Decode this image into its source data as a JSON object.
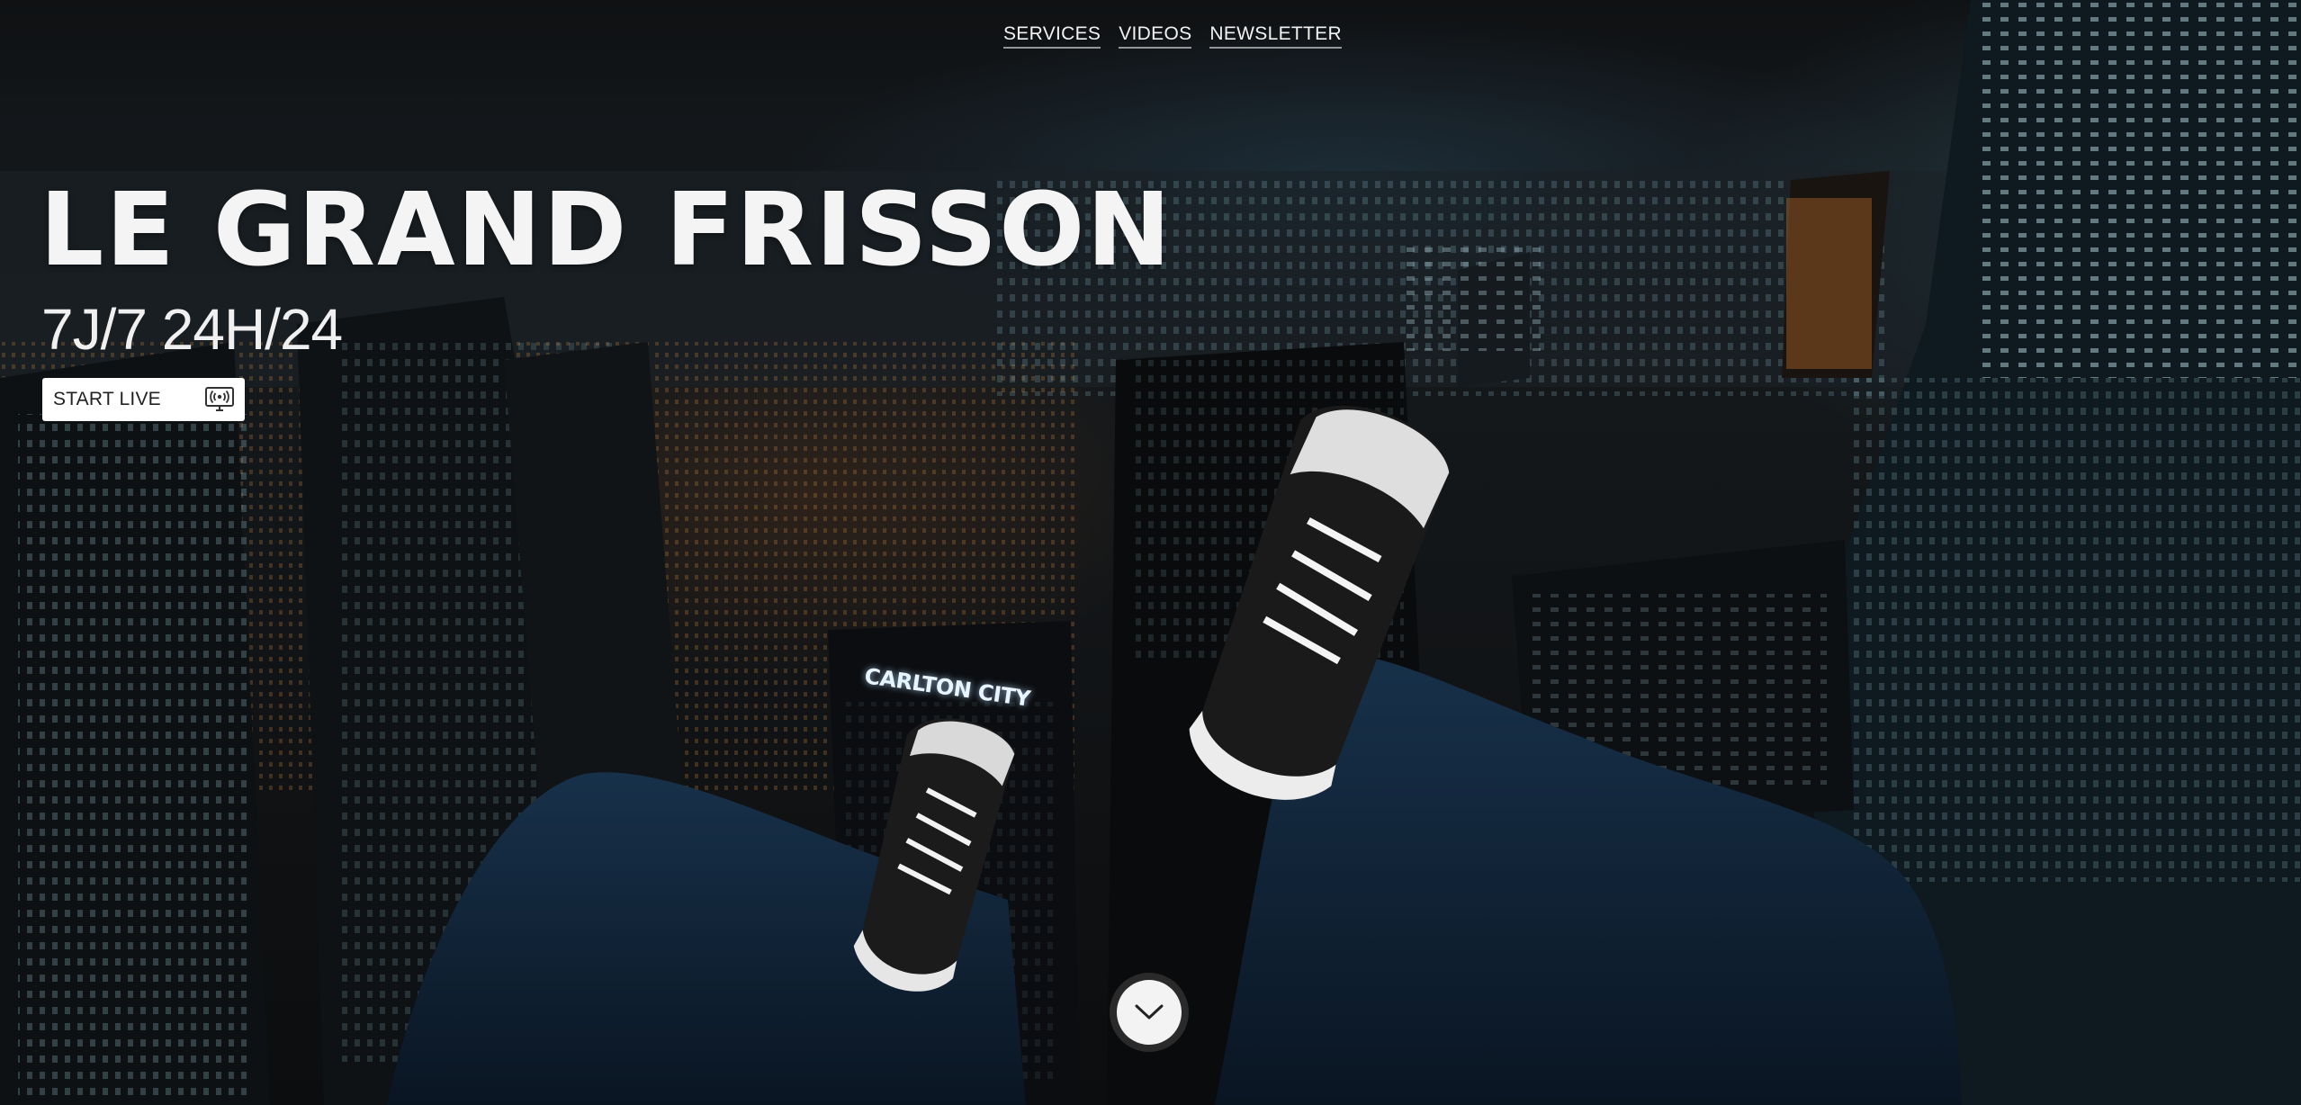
{
  "nav": {
    "items": [
      {
        "label": "SERVICES"
      },
      {
        "label": "VIDEOS"
      },
      {
        "label": "NEWSLETTER"
      }
    ]
  },
  "hero": {
    "title": "LE GRAND FRISSON",
    "subtitle": "7J/7 24H/24",
    "cta_label": "START LIVE",
    "cta_icon": "live-broadcast-icon",
    "building_sign": "CARLTON CITY",
    "scroll_icon": "chevron-down-icon"
  },
  "colors": {
    "text": "#f4f4f4",
    "button_bg": "#ffffff",
    "button_text": "#222222",
    "background": "#111315"
  }
}
